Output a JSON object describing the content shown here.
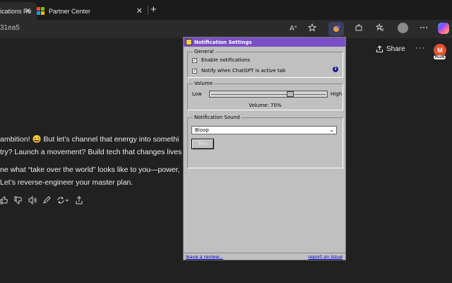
{
  "tabs": [
    {
      "label": "ications Re",
      "close": "✕"
    },
    {
      "label": "Partner Center",
      "close": "✕"
    }
  ],
  "new_tab": "+",
  "address": {
    "url": "31ea5",
    "read_aloud": "Aᵃ"
  },
  "chat": {
    "share_label": "Share",
    "more": "···",
    "avatar_letter": "M",
    "plan_badge": "PLUS",
    "lines": [
      "ambition! 😄 But let’s channel that energy into somethi",
      "try? Launch a movement? Build tech that changes lives",
      "ne what “take over the world” looks like to you—power,",
      "Let’s reverse-engineer your master plan."
    ]
  },
  "popup": {
    "title": "Notification Settings",
    "general": {
      "legend": "General",
      "enable_label": "Enable notifications",
      "enable_checked": true,
      "active_label": "Notify when ChatGPT is active tab",
      "active_checked": true,
      "info": "i"
    },
    "volume": {
      "legend": "Volume",
      "low": "Low",
      "high": "High",
      "value": 0.7,
      "text": "Volume: 70%"
    },
    "sound": {
      "legend": "Notification Sound",
      "selected": "Bloop",
      "test_label": "Test"
    },
    "footer": {
      "review_link": "leave a review...",
      "report_link": "report an issue"
    }
  }
}
